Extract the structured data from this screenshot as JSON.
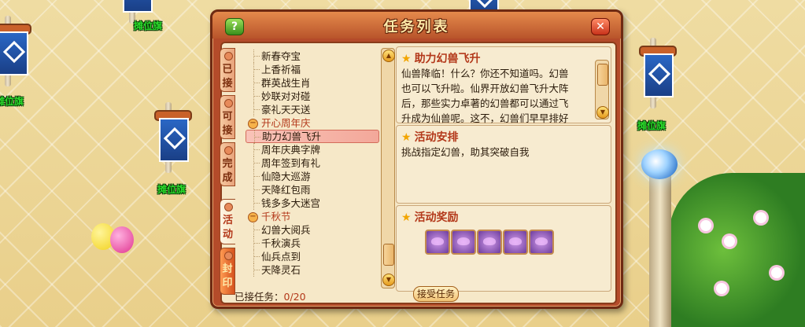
{
  "scene": {
    "stall_labels": [
      "摊位旗",
      "摊位旗",
      "摊位旗",
      "摊位旗"
    ]
  },
  "window": {
    "title": "任务列表",
    "help_label": "?",
    "close_label": "✕"
  },
  "tabs": [
    {
      "label": [
        "已",
        "接"
      ],
      "active": false
    },
    {
      "label": [
        "可",
        "接"
      ],
      "active": false
    },
    {
      "label": [
        "完",
        "成"
      ],
      "active": false
    },
    {
      "label": [
        "活",
        "动"
      ],
      "active": true
    },
    {
      "label": [
        "封",
        "印"
      ],
      "active": false
    }
  ],
  "task_list": [
    {
      "type": "item",
      "label": "新春夺宝"
    },
    {
      "type": "item",
      "label": "上香祈福"
    },
    {
      "type": "item",
      "label": "群英战生肖"
    },
    {
      "type": "item",
      "label": "妙联对对碰"
    },
    {
      "type": "item",
      "label": "豪礼天天送"
    },
    {
      "type": "category",
      "label": "开心周年庆"
    },
    {
      "type": "item",
      "label": "助力幻兽飞升",
      "selected": true
    },
    {
      "type": "item",
      "label": "周年庆典字牌"
    },
    {
      "type": "item",
      "label": "周年签到有礼"
    },
    {
      "type": "item",
      "label": "仙隐大巡游"
    },
    {
      "type": "item",
      "label": "天降红包雨"
    },
    {
      "type": "item",
      "label": "钱多多大迷宫"
    },
    {
      "type": "category",
      "label": "千秋节"
    },
    {
      "type": "item",
      "label": "幻兽大阅兵"
    },
    {
      "type": "item",
      "label": "千秋演兵"
    },
    {
      "type": "item",
      "label": "仙兵点到"
    },
    {
      "type": "item",
      "label": "天降灵石"
    }
  ],
  "detail": {
    "title": "助力幻兽飞升",
    "lines": [
      "仙兽降临！什么？你还不知道吗。幻兽",
      "也可以飞升啦。仙界开放幻兽飞升大阵",
      "后，那些实力卓著的幻兽都可以通过飞",
      "升成为仙兽呢。这不，幻兽们早早排好"
    ]
  },
  "arrangement": {
    "title": "活动安排",
    "text": "挑战指定幻兽，助其突破自我"
  },
  "rewards": {
    "title": "活动奖励",
    "items": [
      "reward-pet-egg",
      "reward-pet-egg",
      "reward-pet-egg",
      "reward-pet-egg",
      "reward-pet-egg"
    ]
  },
  "footer": {
    "label": "已接任务：",
    "count": "0/20",
    "accept_label": "接受任务"
  },
  "colors": {
    "frame": "#b44b2a",
    "parchment": "#f6e8c8",
    "highlight_text": "#b3381a"
  }
}
